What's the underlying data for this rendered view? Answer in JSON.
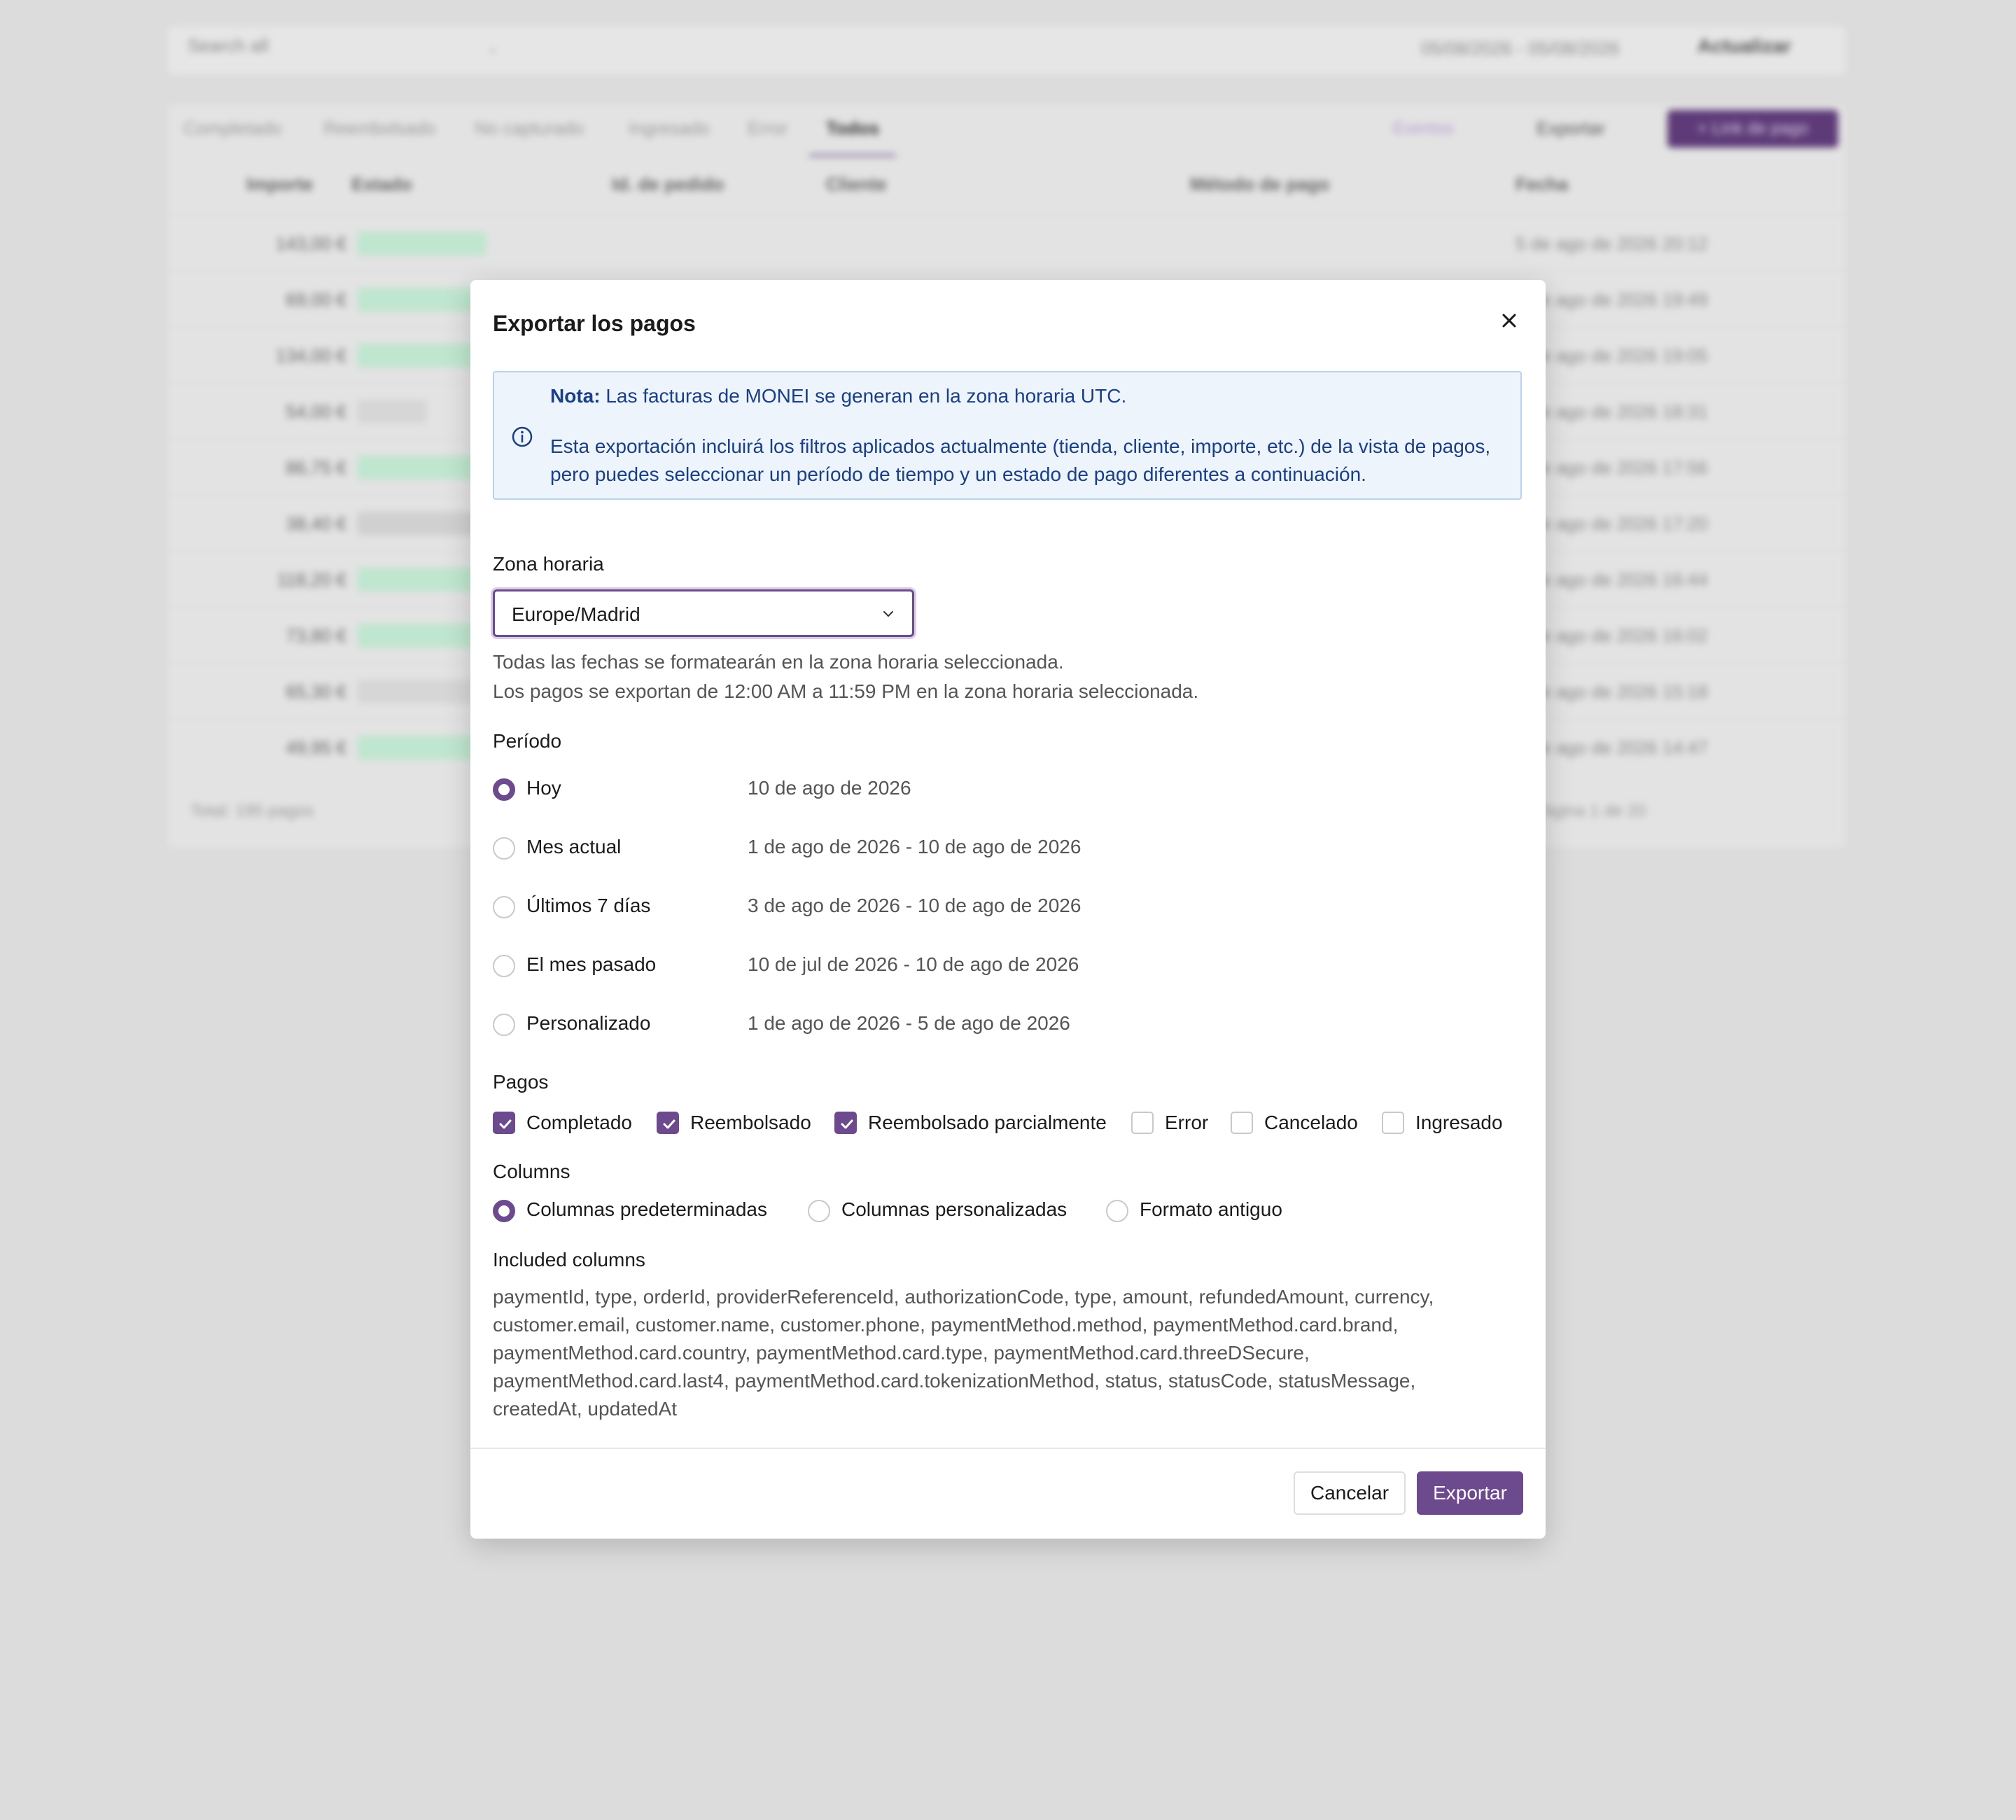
{
  "background": {
    "search_placeholder": "Search all",
    "date_range": "05/08/2026 - 05/08/2026",
    "refresh_label": "Actualizar",
    "tabs": [
      "Completado",
      "Reembolsado",
      "No capturado",
      "Ingresado",
      "Error",
      "Todos"
    ],
    "events_label": "Eventos",
    "export_label": "Exportar",
    "new_link_label": "+ Link de pago",
    "headers": [
      "Importe",
      "Estado",
      "Id. de pedido",
      "Cliente",
      "Método de pago",
      "Fecha"
    ],
    "rows": [
      {
        "amount": "143,00 €",
        "date": "5 de ago de 2026 20:12"
      },
      {
        "amount": "69,00 €",
        "date": "5 de ago de 2026 19:49"
      },
      {
        "amount": "134,00 €",
        "date": "5 de ago de 2026 19:05"
      },
      {
        "amount": "54,00 €",
        "date": "5 de ago de 2026 18:31"
      },
      {
        "amount": "86,75 €",
        "date": "5 de ago de 2026 17:56"
      },
      {
        "amount": "38,40 €",
        "date": "5 de ago de 2026 17:20"
      },
      {
        "amount": "118,20 €",
        "date": "5 de ago de 2026 16:44"
      },
      {
        "amount": "73,80 €",
        "date": "5 de ago de 2026 16:02"
      },
      {
        "amount": "65,30 €",
        "date": "5 de ago de 2026 15:18"
      },
      {
        "amount": "49,95 €",
        "date": "5 de ago de 2026 14:47"
      }
    ],
    "total_label": "Total: 195 pagos",
    "pagination_label": "Página 1 de 20"
  },
  "modal": {
    "title": "Exportar los pagos",
    "note_bold": "Nota:",
    "note_line1": " Las facturas de MONEI se generan en la zona horaria UTC.",
    "note_line2": "Esta exportación incluirá los filtros aplicados actualmente (tienda, cliente, importe, etc.) de la vista de pagos, pero puedes seleccionar un período de tiempo y un estado de pago diferentes a continuación.",
    "timezone_label": "Zona horaria",
    "timezone_value": "Europe/Madrid",
    "timezone_help1": "Todas las fechas se formatearán en la zona horaria seleccionada.",
    "timezone_help2": "Los pagos se exportan de 12:00 AM a 11:59 PM en la zona horaria seleccionada.",
    "period_label": "Período",
    "periods": [
      {
        "label": "Hoy",
        "range": "10 de ago de 2026"
      },
      {
        "label": "Mes actual",
        "range": "1 de ago de 2026 - 10 de ago de 2026"
      },
      {
        "label": "Últimos 7 días",
        "range": "3 de ago de 2026 - 10 de ago de 2026"
      },
      {
        "label": "El mes pasado",
        "range": "10 de jul de 2026 - 10 de ago de 2026"
      },
      {
        "label": "Personalizado",
        "range": "1 de ago de 2026 - 5 de ago de 2026"
      }
    ],
    "selected_period": "Hoy",
    "payments_label": "Pagos",
    "payments": [
      {
        "label": "Completado",
        "checked": true
      },
      {
        "label": "Reembolsado",
        "checked": true
      },
      {
        "label": "Reembolsado parcialmente",
        "checked": true
      },
      {
        "label": "Error",
        "checked": false
      },
      {
        "label": "Cancelado",
        "checked": false
      },
      {
        "label": "Ingresado",
        "checked": false
      }
    ],
    "columns_label": "Columns",
    "column_options": [
      {
        "label": "Columnas predeterminadas",
        "selected": true
      },
      {
        "label": "Columnas personalizadas",
        "selected": false
      },
      {
        "label": "Formato antiguo",
        "selected": false
      }
    ],
    "included_label": "Included columns",
    "included_columns": "paymentId, type, orderId, providerReferenceId, authorizationCode, type, amount, refundedAmount, currency, customer.email, customer.name, customer.phone, paymentMethod.method, paymentMethod.card.brand, paymentMethod.card.country, paymentMethod.card.type, paymentMethod.card.threeDSecure, paymentMethod.card.last4, paymentMethod.card.tokenizationMethod, status, statusCode, statusMessage, createdAt, updatedAt",
    "cancel_label": "Cancelar",
    "export_label": "Exportar"
  },
  "colors": {
    "accent": "#6d4a8d",
    "note_bg": "#eef4fc",
    "note_border": "#b9d2ee",
    "note_text": "#1a3f85",
    "overlay": "#dcdcdc"
  },
  "icons": [
    "info-icon",
    "close-icon",
    "chevron-down-icon",
    "check-icon",
    "calendar-icon",
    "refresh-icon",
    "download-icon"
  ]
}
